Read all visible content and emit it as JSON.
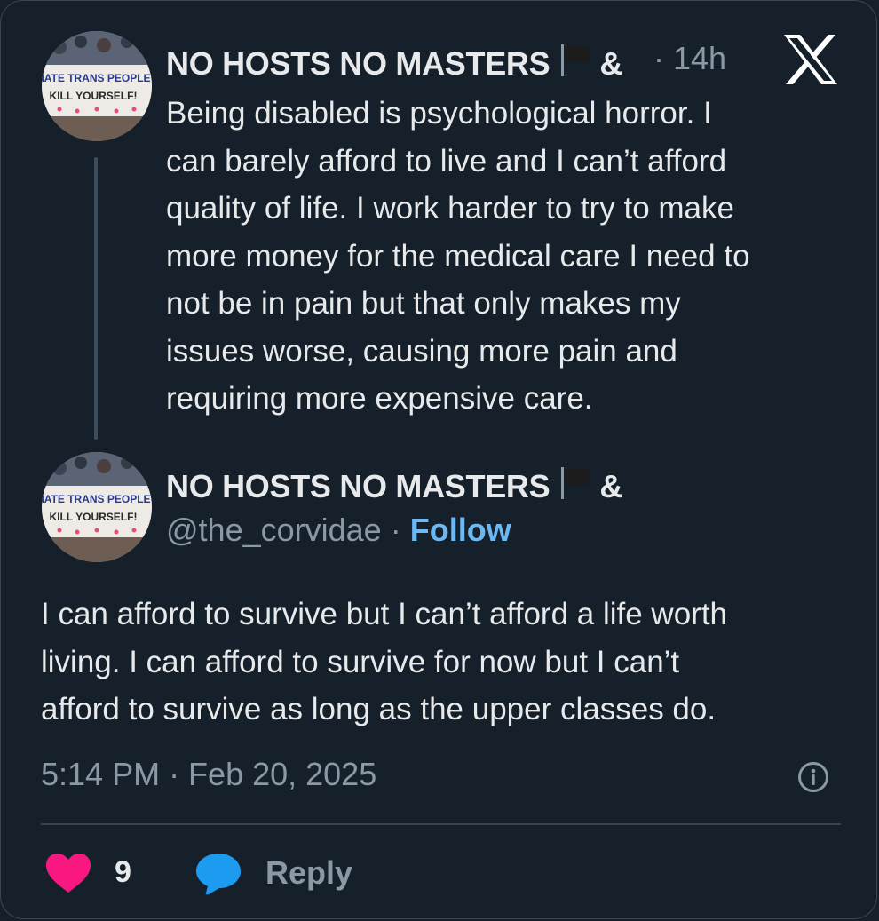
{
  "parent_post": {
    "display_name": "NO HOSTS NO MASTERS",
    "name_suffix": "&",
    "separator": "·",
    "time_ago": "14h",
    "text": "Being disabled is psychological horror. I\ncan barely afford to live and I can’t afford\nquality of life. I work harder to try to make\nmore money for the medical care I need to\nnot be in pain but that only makes my\nissues worse, causing more pain and\nrequiring more expensive care.",
    "avatar_sign_lines": [
      "HATE TRANS PEOPLE?",
      "KILL YOURSELF!"
    ]
  },
  "main_post": {
    "display_name": "NO HOSTS NO MASTERS",
    "name_suffix": "&",
    "handle": "@the_corvidae",
    "separator": "·",
    "follow_label": "Follow",
    "text": "I can afford to survive but I can’t afford a life worth\nliving. I can afford to survive for now but I can’t\nafford to survive as long as the upper classes do.",
    "timestamp": "5:14 PM · Feb 20, 2025",
    "avatar_sign_lines": [
      "HATE TRANS PEOPLE?",
      "KILL YOURSELF!"
    ]
  },
  "actions": {
    "like_count": "9",
    "reply_label": "Reply"
  },
  "icons": {
    "logo": "x-logo-icon",
    "flag": "black-flag-icon",
    "info": "info-icon",
    "like": "heart-icon",
    "reply": "reply-bubble-icon"
  },
  "colors": {
    "background": "#15202b",
    "text": "#e7e9ea",
    "muted": "#8b98a5",
    "link": "#6cb8f2",
    "heart": "#f91880",
    "reply_icon": "#1d9bf0"
  }
}
